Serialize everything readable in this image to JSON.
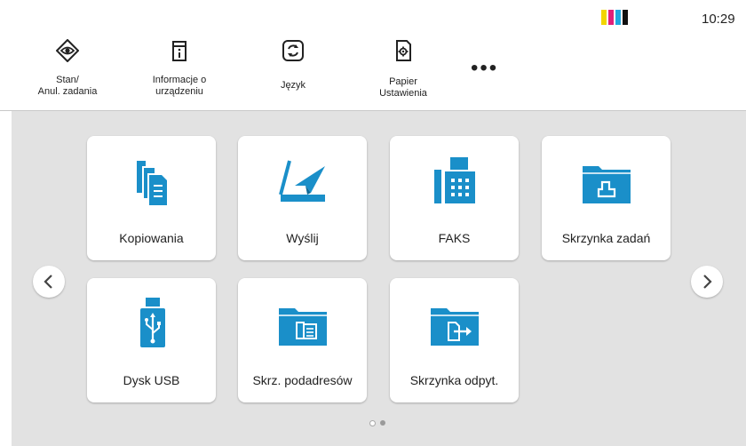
{
  "status": {
    "time": "10:29",
    "toner_colors": [
      "#f2d500",
      "#e0207a",
      "#1fa8e0",
      "#111111"
    ]
  },
  "topbar": {
    "items": [
      {
        "label_line1": "Stan/",
        "label_line2": "Anul. zadania",
        "icon": "eye-icon"
      },
      {
        "label_line1": "Informacje o",
        "label_line2": "urządzeniu",
        "icon": "device-info-icon"
      },
      {
        "label_line1": "Język",
        "label_line2": "",
        "icon": "language-icon"
      },
      {
        "label_line1": "Papier",
        "label_line2": "Ustawienia",
        "icon": "paper-settings-icon"
      }
    ],
    "more_label": "•••"
  },
  "tiles": [
    {
      "label": "Kopiowania",
      "icon": "copy-icon"
    },
    {
      "label": "Wyślij",
      "icon": "send-icon"
    },
    {
      "label": "FAKS",
      "icon": "fax-icon"
    },
    {
      "label": "Skrzynka zadań",
      "icon": "job-box-icon"
    },
    {
      "label": "Dysk USB",
      "icon": "usb-drive-icon"
    },
    {
      "label": "Skrz. podadresów",
      "icon": "subaddress-box-icon"
    },
    {
      "label": "Skrzynka odpyt.",
      "icon": "polling-box-icon"
    }
  ],
  "pager": {
    "pages": 2,
    "current": 1
  },
  "colors": {
    "accent": "#1a8fc9",
    "background": "#e2e2e2",
    "tile": "#ffffff"
  }
}
